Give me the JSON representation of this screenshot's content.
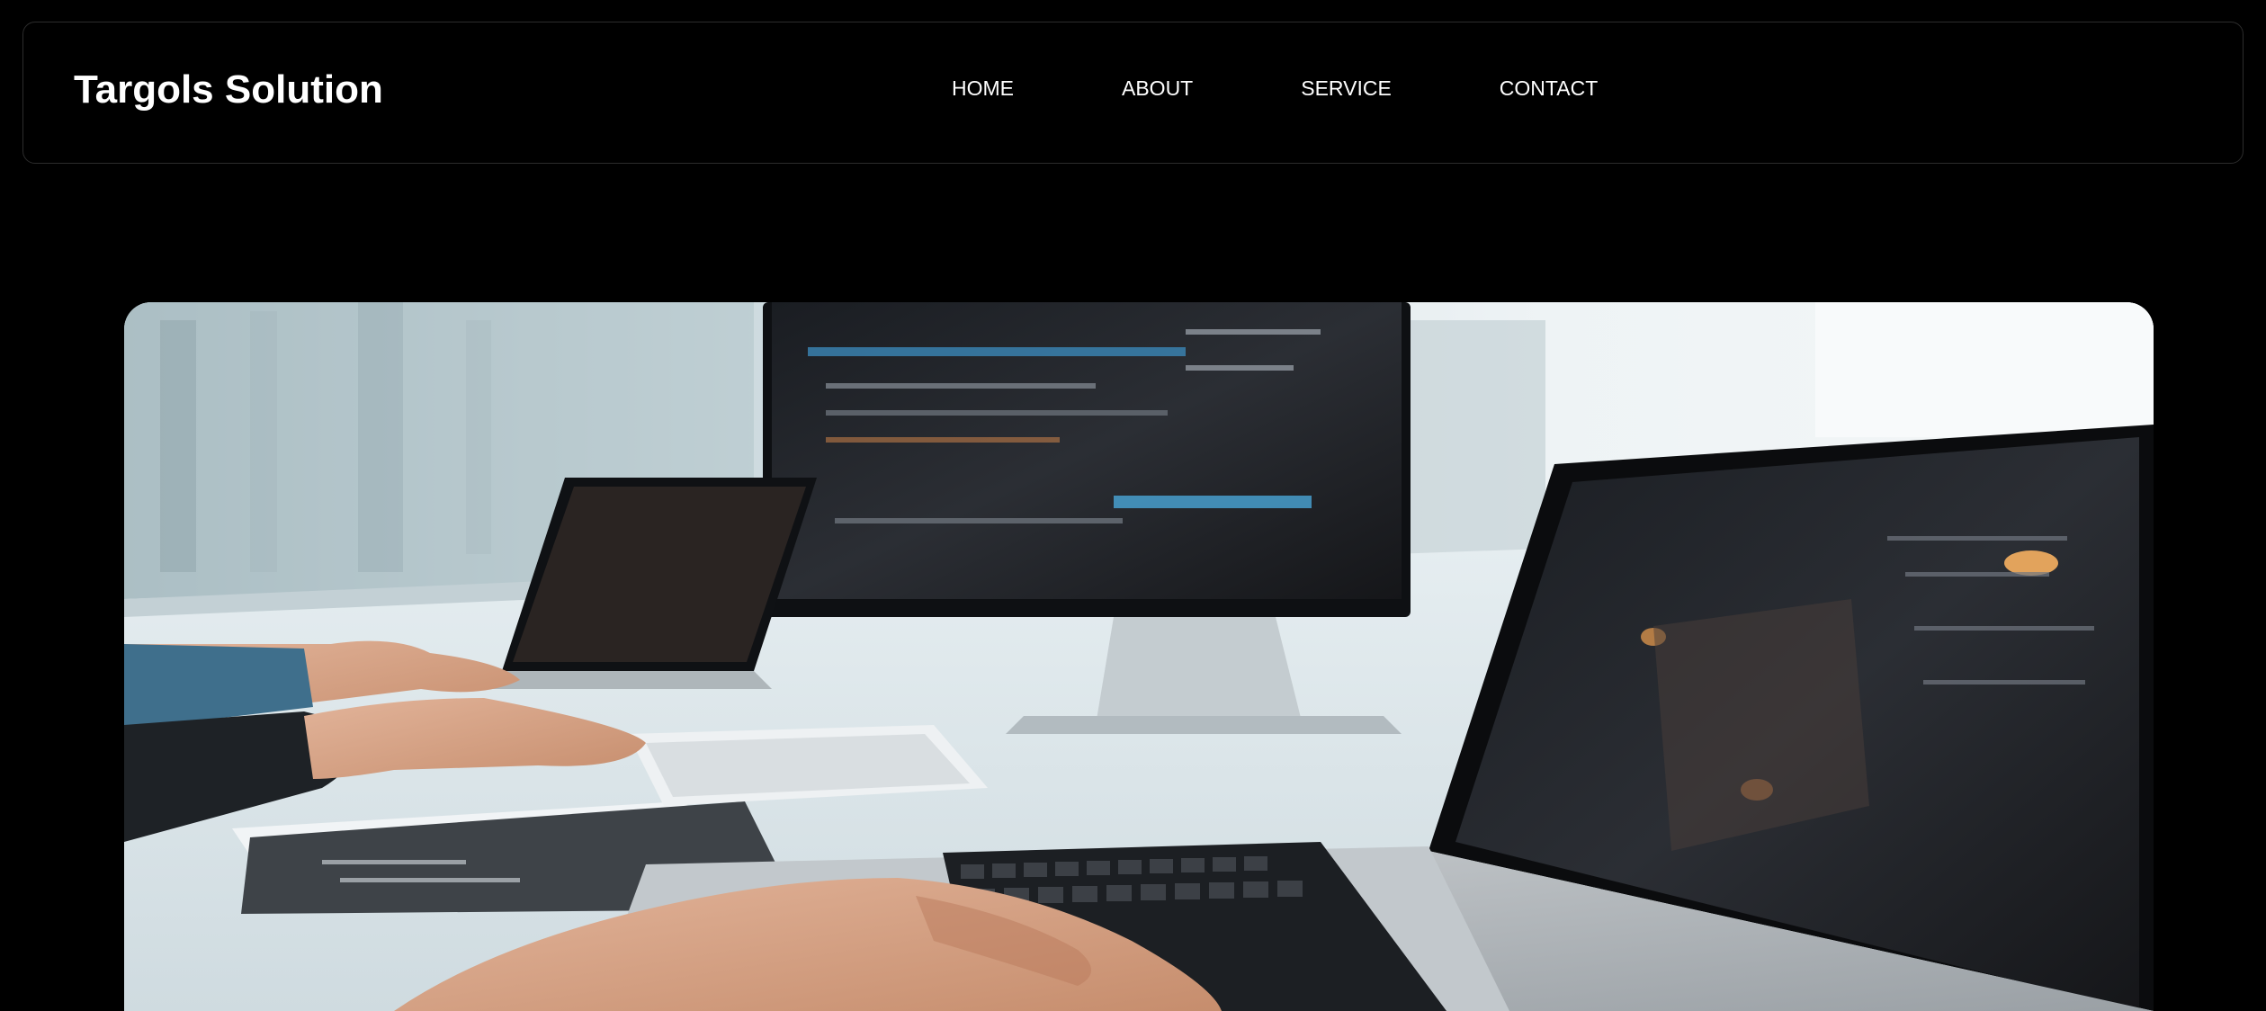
{
  "header": {
    "brand": "Targols Solution",
    "nav": [
      {
        "label": "HOME"
      },
      {
        "label": "ABOUT"
      },
      {
        "label": "SERVICE"
      },
      {
        "label": "CONTACT"
      }
    ]
  },
  "hero": {
    "image_subject": "developers-coding-on-laptops-photo"
  },
  "colors": {
    "background": "#000000",
    "nav_border": "#2c2c2c",
    "text": "#ffffff"
  }
}
